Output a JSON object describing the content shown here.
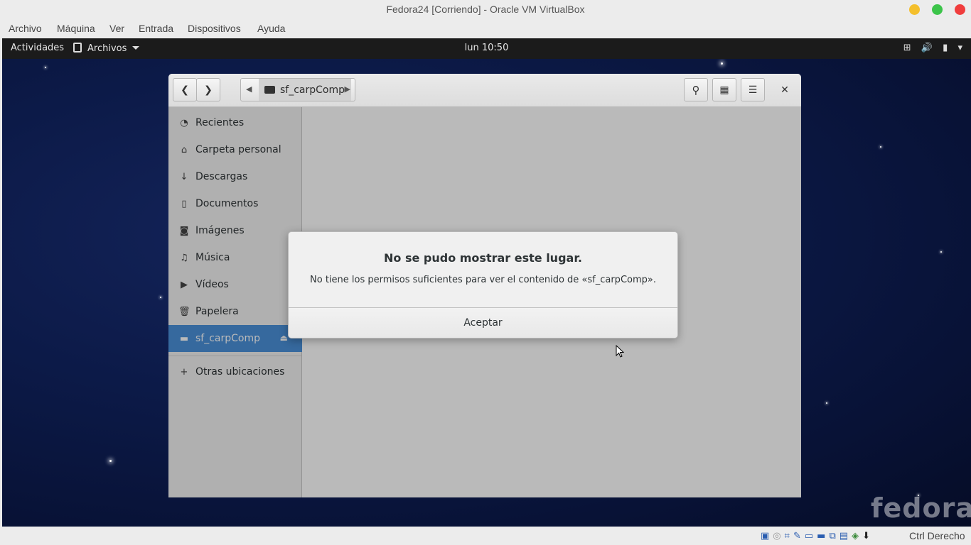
{
  "host": {
    "title": "Fedora24 [Corriendo] - Oracle VM VirtualBox",
    "menu": [
      "Archivo",
      "Máquina",
      "Ver",
      "Entrada",
      "Dispositivos",
      "Ayuda"
    ],
    "status_label": "Ctrl Derecho",
    "status_icons": [
      "hdd-icon",
      "optical-icon",
      "usb-icon",
      "pen-icon",
      "shared-folder-icon",
      "display-icon",
      "capture-icon",
      "chip-icon",
      "network-icon",
      "keyboard-icon"
    ]
  },
  "gnome": {
    "activities": "Actividades",
    "app_menu": "Archivos",
    "clock": "lun 10:50",
    "status_icons": [
      "network-icon",
      "volume-icon",
      "battery-icon",
      "dropdown-icon"
    ]
  },
  "nautilus": {
    "path_segment": "sf_carpComp",
    "sidebar": [
      {
        "label": "Recientes",
        "icon": "clock-icon"
      },
      {
        "label": "Carpeta personal",
        "icon": "home-icon"
      },
      {
        "label": "Descargas",
        "icon": "download-icon"
      },
      {
        "label": "Documentos",
        "icon": "document-icon"
      },
      {
        "label": "Imágenes",
        "icon": "camera-icon"
      },
      {
        "label": "Música",
        "icon": "music-icon"
      },
      {
        "label": "Vídeos",
        "icon": "video-icon"
      },
      {
        "label": "Papelera",
        "icon": "trash-icon"
      },
      {
        "label": "sf_carpComp",
        "icon": "drive-icon",
        "active": true
      },
      {
        "label": "Otras ubicaciones",
        "icon": "plus-icon"
      }
    ]
  },
  "dialog": {
    "title": "No se pudo mostrar este lugar.",
    "message": "No tiene los permisos suficientes para ver el contenido de «sf_carpComp».",
    "button": "Aceptar"
  },
  "wallpaper_logo": "fedora"
}
